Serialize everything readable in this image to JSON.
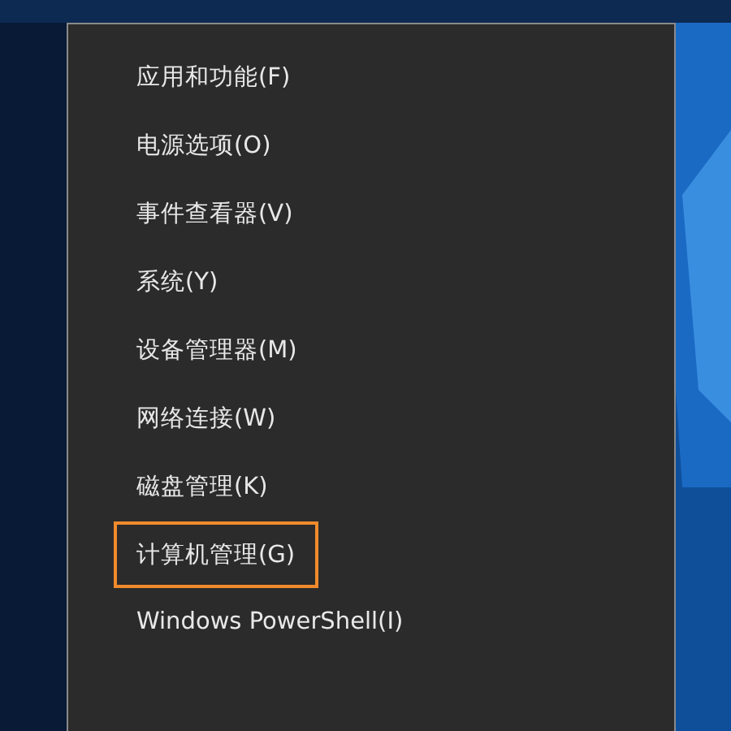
{
  "menu": {
    "items": [
      {
        "label": "应用和功能(F)",
        "highlighted": false
      },
      {
        "label": "电源选项(O)",
        "highlighted": false
      },
      {
        "label": "事件查看器(V)",
        "highlighted": false
      },
      {
        "label": "系统(Y)",
        "highlighted": false
      },
      {
        "label": "设备管理器(M)",
        "highlighted": false
      },
      {
        "label": "网络连接(W)",
        "highlighted": false
      },
      {
        "label": "磁盘管理(K)",
        "highlighted": false
      },
      {
        "label": "计算机管理(G)",
        "highlighted": true
      },
      {
        "label": "Windows PowerShell(I)",
        "highlighted": false
      }
    ]
  }
}
